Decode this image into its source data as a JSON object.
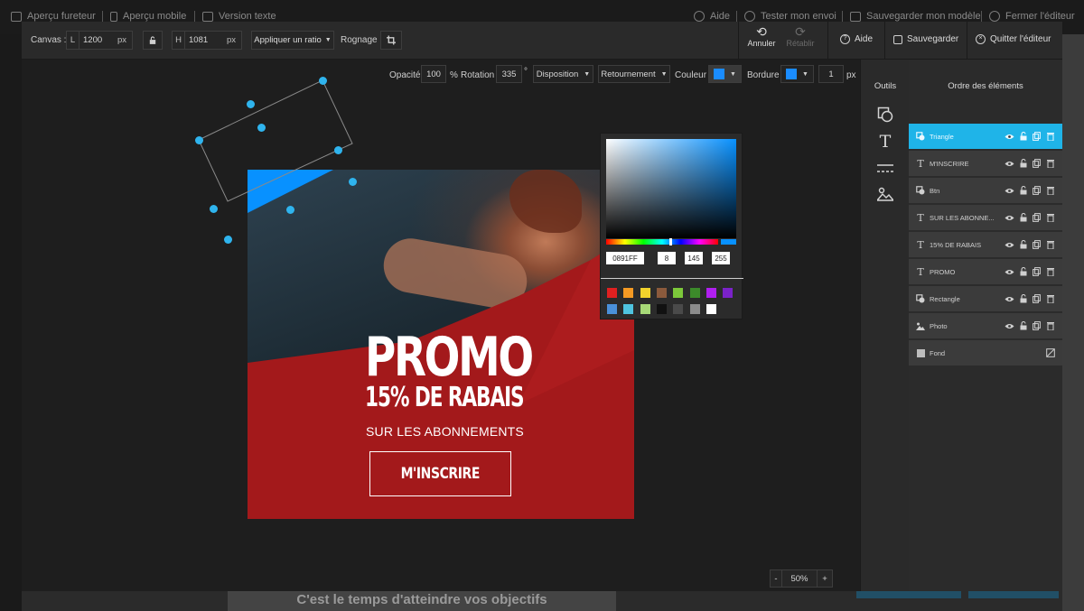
{
  "background": {
    "topbar": [
      {
        "label": "Aperçu fureteur",
        "icon": "monitor-icon"
      },
      {
        "label": "Aperçu mobile",
        "icon": "mobile-icon"
      },
      {
        "label": "Version texte",
        "icon": "text-window-icon"
      },
      {
        "label": "Aide",
        "icon": "help-icon"
      },
      {
        "label": "Tester mon envoi",
        "icon": "check-icon"
      },
      {
        "label": "Sauvegarder mon modèle",
        "icon": "save-icon"
      },
      {
        "label": "Fermer l'éditeur",
        "icon": "close-circle-icon"
      }
    ],
    "bottom_text": "C'est le temps d'atteindre vos objectifs"
  },
  "toolbar": {
    "canvas_label": "Canvas :",
    "width_prefix": "L",
    "width_value": "1200",
    "width_unit": "px",
    "height_prefix": "H",
    "height_value": "1081",
    "height_unit": "px",
    "ratio_button": "Appliquer un ratio",
    "crop_label": "Rognage :",
    "undo": "Annuler",
    "redo": "Rétablir",
    "help": "Aide",
    "save": "Sauvegarder",
    "quit": "Quitter l'éditeur"
  },
  "properties": {
    "opacity_label": "Opacité",
    "opacity_value": "100",
    "opacity_unit": "%",
    "rotation_label": "Rotation",
    "rotation_value": "335",
    "rotation_unit": "°",
    "disposition": "Disposition",
    "flip": "Retournement",
    "color_label": "Couleur",
    "border_label": "Bordure",
    "border_width": "1",
    "border_unit": "px",
    "color_value": "#0891ff",
    "border_color": "#1a8cff"
  },
  "color_picker": {
    "hex": "0891FF",
    "r": "8",
    "g": "145",
    "b": "255",
    "palette": [
      "#e02020",
      "#f59a23",
      "#f2d22c",
      "#8b5a3c",
      "#7cc83a",
      "#3c8a2a",
      "#b01ff0",
      "#7a22c8",
      "#4a90d9",
      "#4fc3df",
      "#a7d977",
      "#111111",
      "#4a4a4a",
      "#8c8c8c",
      "#ffffff"
    ]
  },
  "artboard": {
    "title": "PROMO",
    "subtitle": "15% DE RABAIS",
    "tagline": "SUR LES ABONNEMENTS",
    "cta": "M'INSCRIRE",
    "triangle_color": "#0891ff",
    "red_color": "#a3191b"
  },
  "zoom": {
    "minus": "-",
    "value": "50%",
    "plus": "+"
  },
  "tools": {
    "title": "Outils",
    "items": [
      "shapes-icon",
      "text-icon",
      "lines-icon",
      "image-icon"
    ]
  },
  "layers": {
    "title": "Ordre des éléments",
    "items": [
      {
        "name": "Triangle",
        "icon": "shape-icon",
        "active": true
      },
      {
        "name": "M'INSCRIRE",
        "icon": "text-icon",
        "active": false
      },
      {
        "name": "Btn",
        "icon": "shape-icon",
        "active": false
      },
      {
        "name": "SUR LES ABONNE...",
        "icon": "text-icon",
        "active": false
      },
      {
        "name": "15% DE RABAIS",
        "icon": "text-icon",
        "active": false
      },
      {
        "name": "PROMO",
        "icon": "text-icon",
        "active": false
      },
      {
        "name": "Rectangle",
        "icon": "shape-icon",
        "active": false
      },
      {
        "name": "Photo",
        "icon": "image-icon",
        "active": false
      },
      {
        "name": "Fond",
        "icon": "background-swatch-icon",
        "active": false
      }
    ]
  }
}
